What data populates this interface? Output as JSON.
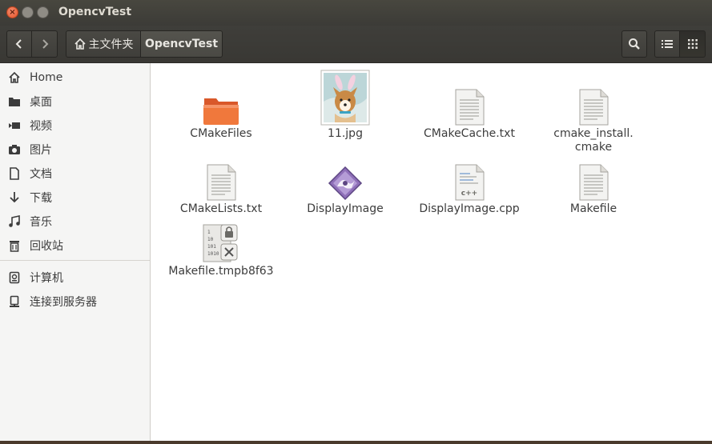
{
  "window": {
    "title": "OpencvTest",
    "close_glyph": "×",
    "min_glyph": "–",
    "max_glyph": "□"
  },
  "toolbar": {
    "breadcrumb_home": "主文件夹",
    "breadcrumb_current": "OpencvTest"
  },
  "sidebar": {
    "items": [
      {
        "label": "Home",
        "icon": "home-icon"
      },
      {
        "label": "桌面",
        "icon": "desktop-folder-icon"
      },
      {
        "label": "视频",
        "icon": "video-icon"
      },
      {
        "label": "图片",
        "icon": "camera-icon"
      },
      {
        "label": "文档",
        "icon": "document-icon"
      },
      {
        "label": "下载",
        "icon": "download-icon"
      },
      {
        "label": "音乐",
        "icon": "music-icon"
      },
      {
        "label": "回收站",
        "icon": "trash-icon"
      },
      {
        "label": "计算机",
        "icon": "computer-icon"
      },
      {
        "label": "连接到服务器",
        "icon": "server-icon"
      }
    ]
  },
  "files": [
    {
      "name": "CMakeFiles",
      "type": "folder"
    },
    {
      "name": "11.jpg",
      "type": "image"
    },
    {
      "name": "CMakeCache.txt",
      "type": "text"
    },
    {
      "name": "cmake_install.",
      "name2": "cmake",
      "type": "text"
    },
    {
      "name": "CMakeLists.txt",
      "type": "text"
    },
    {
      "name": "DisplayImage",
      "type": "executable"
    },
    {
      "name": "DisplayImage.cpp",
      "type": "cpp"
    },
    {
      "name": "Makefile",
      "type": "text"
    },
    {
      "name": "Makefile.tmpb8f63",
      "type": "binary-locked"
    }
  ],
  "colors": {
    "titlebar": "#3c3b37",
    "folder_orange": "#f0783c",
    "close_button": "#e3552c"
  }
}
